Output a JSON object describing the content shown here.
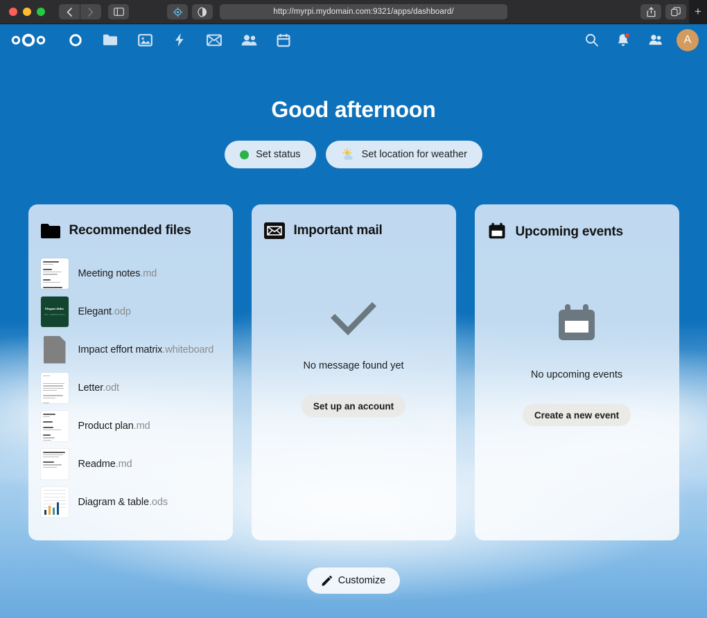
{
  "browser": {
    "url": "http://myrpi.mydomain.com:9321/apps/dashboard/",
    "back_label": "Back",
    "forward_label": "Forward",
    "sidebar_label": "Show sidebar",
    "privacy_label": "Privacy Report",
    "reader_label": "Reader",
    "share_label": "Share",
    "tabs_label": "Tab Overview",
    "newtab_label": "+"
  },
  "appnav": {
    "logo_name": "Nextcloud",
    "apps": [
      {
        "name": "dashboard",
        "label": "Dashboard"
      },
      {
        "name": "files",
        "label": "Files"
      },
      {
        "name": "photos",
        "label": "Photos"
      },
      {
        "name": "activity",
        "label": "Activity"
      },
      {
        "name": "mail",
        "label": "Mail"
      },
      {
        "name": "contacts",
        "label": "Contacts"
      },
      {
        "name": "calendar",
        "label": "Calendar"
      }
    ],
    "search_label": "Search",
    "notifications_label": "Notifications",
    "contacts_label": "Contacts menu",
    "avatar_initial": "A"
  },
  "hero": {
    "greeting": "Good afternoon",
    "status_pill": "Set status",
    "weather_pill": "Set location for weather",
    "status_color": "#2db14b"
  },
  "widgets": {
    "files": {
      "title": "Recommended files",
      "items": [
        {
          "name": "Meeting notes",
          "ext": ".md",
          "thumb": "doc-notes"
        },
        {
          "name": "Elegant",
          "ext": ".odp",
          "thumb": "slide-green",
          "slide_title": "Elegant slides",
          "slide_sub": "Your subtitle here"
        },
        {
          "name": "Impact effort matrix",
          "ext": ".whiteboard",
          "thumb": "whiteboard-gray"
        },
        {
          "name": "Letter",
          "ext": ".odt",
          "thumb": "doc-letter"
        },
        {
          "name": "Product plan",
          "ext": ".md",
          "thumb": "doc-plan"
        },
        {
          "name": "Readme",
          "ext": ".md",
          "thumb": "doc-readme"
        },
        {
          "name": "Diagram & table",
          "ext": ".ods",
          "thumb": "spreadsheet-chart"
        }
      ]
    },
    "mail": {
      "title": "Important mail",
      "empty_text": "No message found yet",
      "button": "Set up an account"
    },
    "events": {
      "title": "Upcoming events",
      "empty_text": "No upcoming events",
      "button": "Create a new event"
    }
  },
  "footer": {
    "customize": "Customize"
  },
  "colors": {
    "primary": "#0e71bb",
    "widget_bg": "#c7ddf2",
    "avatar": "#d49a5e",
    "badge": "#e8453c"
  }
}
